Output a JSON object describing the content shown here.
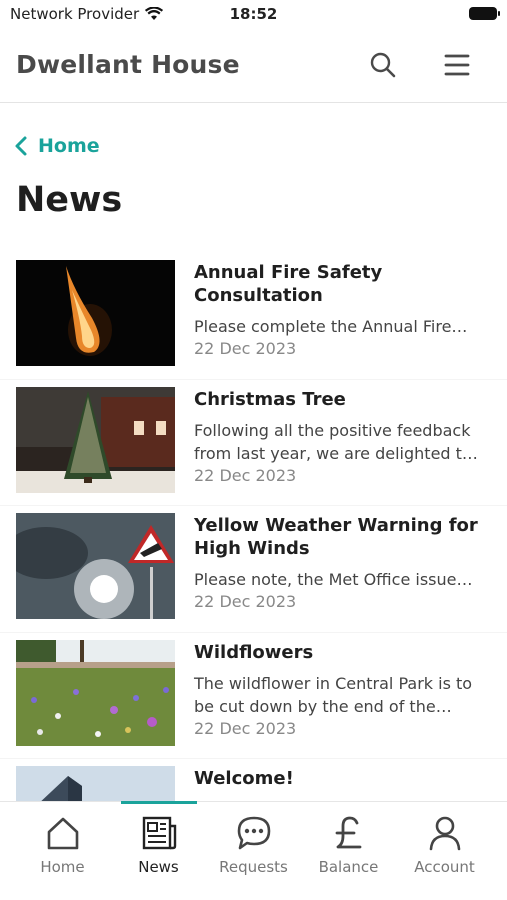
{
  "status_bar": {
    "carrier": "Network Provider",
    "time": "18:52"
  },
  "header": {
    "title": "Dwellant House",
    "icons": [
      "search-icon",
      "menu-icon"
    ]
  },
  "breadcrumb": {
    "label": "Home"
  },
  "page": {
    "title": "News"
  },
  "news": [
    {
      "title": "Annual Fire Safety Consultation",
      "excerpt": "Please complete the Annual Fire…",
      "date": "22 Dec 2023",
      "image": "candle-flame"
    },
    {
      "title": "Christmas Tree",
      "excerpt": "Following all the positive feedback from last year, we are delighted t…",
      "date": "22 Dec 2023",
      "image": "christmas-tree"
    },
    {
      "title": "Yellow Weather Warning for High Winds",
      "excerpt": "Please note, the Met Office issue…",
      "date": "22 Dec 2023",
      "image": "wind-warning-sign"
    },
    {
      "title": "Wildflowers",
      "excerpt": "The wildflower in Central Park is to be cut down by the end of the…",
      "date": "22 Dec 2023",
      "image": "wildflower-meadow"
    },
    {
      "title": "Welcome!",
      "excerpt": "",
      "date": "",
      "image": "building"
    }
  ],
  "tabs": [
    {
      "label": "Home",
      "icon": "home-icon"
    },
    {
      "label": "News",
      "icon": "newspaper-icon",
      "active": true
    },
    {
      "label": "Requests",
      "icon": "chat-icon"
    },
    {
      "label": "Balance",
      "icon": "pound-icon"
    },
    {
      "label": "Account",
      "icon": "person-icon"
    }
  ],
  "colors": {
    "accent": "#1aa39b",
    "title": "#4a4a4a"
  }
}
